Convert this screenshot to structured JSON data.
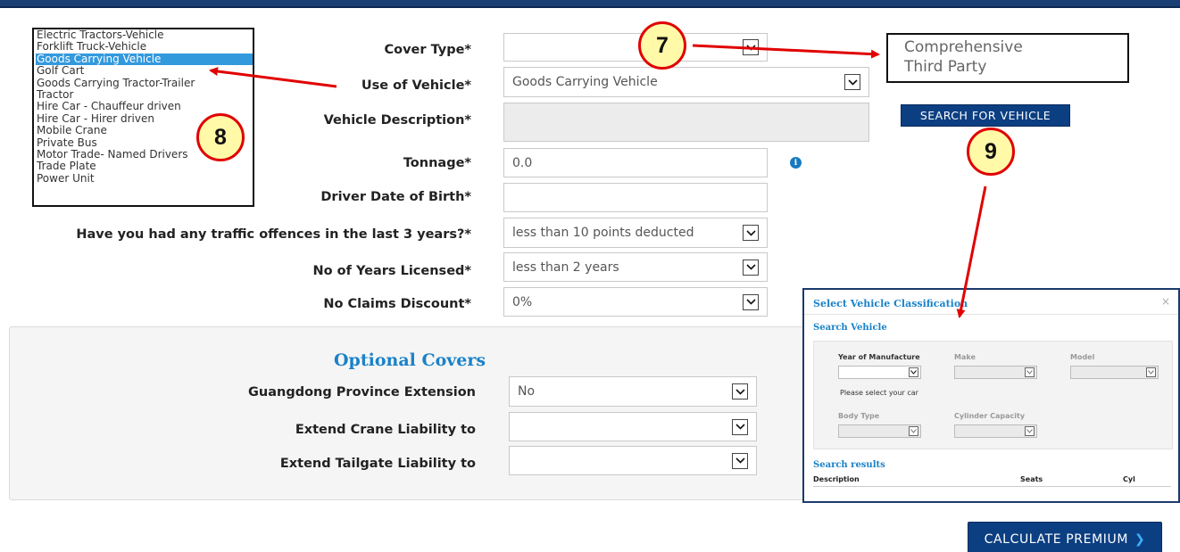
{
  "colors": {
    "header": "#1b3f73",
    "accent": "#1a82c8",
    "button": "#0c3f82",
    "annotation_red": "#e10000",
    "badge_fill": "#fff9a8"
  },
  "vehicle_list": {
    "items": [
      "Electric Tractors-Vehicle",
      "Forklift Truck-Vehicle",
      "Goods Carrying Vehicle",
      "Golf Cart",
      "Goods Carrying Tractor-Trailer",
      "Tractor",
      "Hire Car - Chauffeur driven",
      "Hire Car - Hirer driven",
      "Mobile Crane",
      "Private Bus",
      "Motor Trade- Named Drivers",
      "Trade Plate",
      "Power Unit"
    ],
    "selected_index": 2
  },
  "form": {
    "cover_type": {
      "label": "Cover Type*",
      "value": ""
    },
    "use_of_vehicle": {
      "label": "Use of Vehicle*",
      "value": "Goods Carrying Vehicle"
    },
    "vehicle_description": {
      "label": "Vehicle Description*",
      "value": ""
    },
    "tonnage": {
      "label": "Tonnage*",
      "value": "0.0",
      "info_icon": "info-icon"
    },
    "driver_dob": {
      "label": "Driver Date of Birth*",
      "value": ""
    },
    "traffic_offences": {
      "label": "Have you had any traffic offences in the last 3 years?*",
      "value": "less than 10 points deducted"
    },
    "years_licensed": {
      "label": "No of Years Licensed*",
      "value": "less than 2 years"
    },
    "ncd": {
      "label": "No Claims Discount*",
      "value": "0%"
    }
  },
  "cover_options": {
    "items": [
      "Comprehensive",
      "Third Party"
    ]
  },
  "search_button_label": "SEARCH FOR VEHICLE",
  "optional": {
    "title": "Optional Covers",
    "guangdong": {
      "label": "Guangdong Province Extension",
      "value": "No"
    },
    "crane": {
      "label": "Extend Crane Liability to",
      "value": ""
    },
    "tailgate": {
      "label": "Extend Tailgate Liability to",
      "value": ""
    }
  },
  "calc_button": {
    "label": "CALCULATE PREMIUM",
    "icon": "chevron-right-icon"
  },
  "annotations": {
    "seven": "7",
    "eight": "8",
    "nine": "9"
  },
  "modal": {
    "title": "Select Vehicle Classification",
    "close": "×",
    "search_title": "Search Vehicle",
    "year_label": "Year of Manufacture",
    "make_label": "Make",
    "model_label": "Model",
    "hint": "Please select your car",
    "body_label": "Body Type",
    "cyl_label": "Cylinder Capacity",
    "results_title": "Search results",
    "col_description": "Description",
    "col_seats": "Seats",
    "col_cyl": "Cyl"
  }
}
